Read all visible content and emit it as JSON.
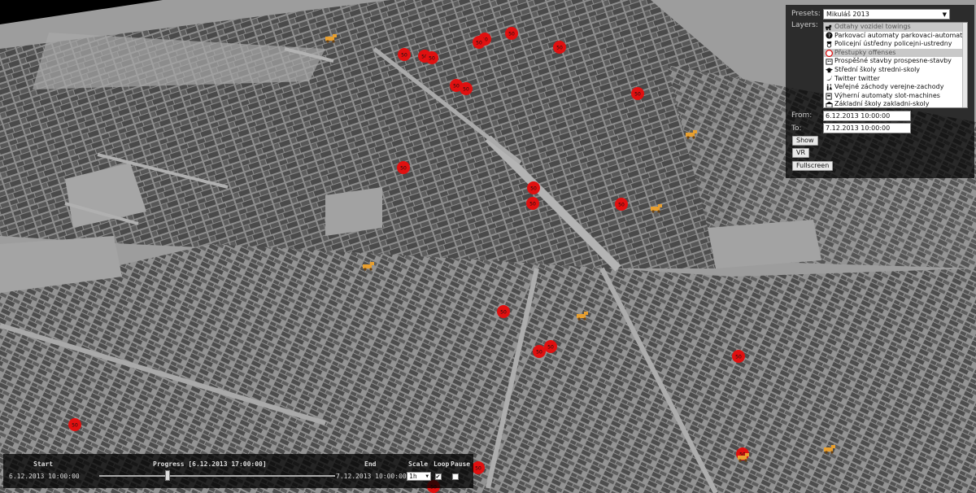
{
  "panel": {
    "presets_label": "Presets:",
    "preset_value": "Mikuláš 2013",
    "layers_label": "Layers:",
    "layers": [
      {
        "label": "Odtahy vozidel towings",
        "icon": "tow-truck-icon",
        "selected": true
      },
      {
        "label": "Parkovací automaty parkovaci-automaty",
        "icon": "parking-icon",
        "selected": false
      },
      {
        "label": "Policejní ústředny policejni-ustredny",
        "icon": "police-icon",
        "selected": false
      },
      {
        "label": "Přestupky offenses",
        "icon": "speed-sign-icon",
        "selected": true
      },
      {
        "label": "Prospěšné stavby prospesne-stavby",
        "icon": "building-icon",
        "selected": false
      },
      {
        "label": "Střední školy stredni-skoly",
        "icon": "graduation-cap-icon",
        "selected": false
      },
      {
        "label": "Twitter twitter",
        "icon": "twitter-icon",
        "selected": false
      },
      {
        "label": "Veřejné záchody verejne-zachody",
        "icon": "toilet-icon",
        "selected": false
      },
      {
        "label": "Výherní automaty slot-machines",
        "icon": "slot-machine-icon",
        "selected": false
      },
      {
        "label": "Základní školy zakladni-skoly",
        "icon": "school-icon",
        "selected": false
      }
    ],
    "from_label": "From:",
    "from_value": "6.12.2013 10:00:00",
    "to_label": "To:",
    "to_value": "7.12.2013 10:00:00",
    "show_label": "Show",
    "vr_label": "VR",
    "fullscreen_label": "Fullscreen"
  },
  "timeline": {
    "start_label": "Start",
    "start_value": "6.12.2013 10:00:00",
    "progress_label": "Progress [6.12.2013 17:00:00]",
    "progress_fraction": 0.29,
    "end_label": "End",
    "end_value": "7.12.2013 10:00:00",
    "scale_label": "Scale",
    "scale_value": "1h",
    "loop_label": "Loop",
    "loop_checked": true,
    "pause_label": "Pause",
    "pause_checked": false
  },
  "map": {
    "speed_sign_text": "50",
    "colors": {
      "ground": "#9a9a9a",
      "building": "#5a5a5a",
      "offense_marker": "#e01010",
      "tow_marker": "#e8a030"
    }
  }
}
